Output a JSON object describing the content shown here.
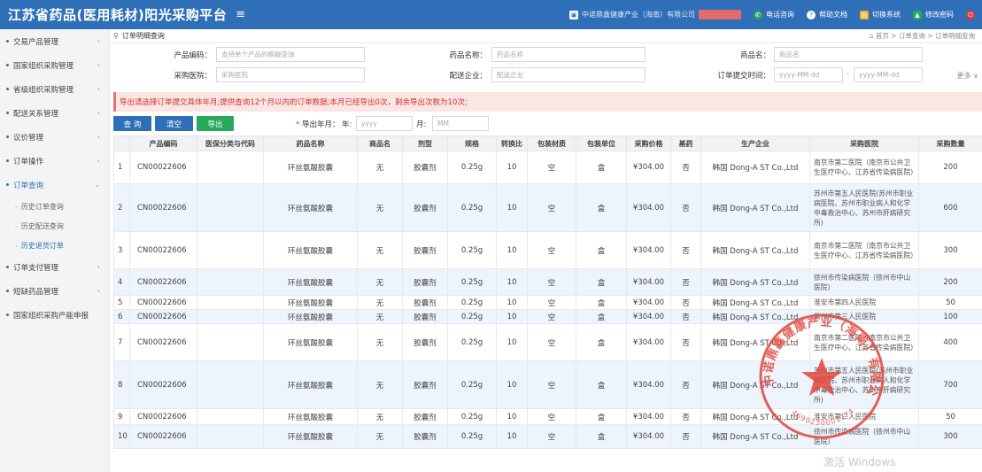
{
  "header": {
    "title": "江苏省药品(医用耗材)阳光采购平台",
    "menu_icon": "≡",
    "company": "中诺鼎鑫健康产业（海南）有限公司",
    "phone_query": "电话咨询",
    "help_docs": "帮助文档",
    "switch_system": "切换系统",
    "change_password": "修改密码",
    "exit_icon": "power-icon"
  },
  "sidebar": {
    "items": [
      {
        "label": "交易产品管理",
        "arrow": "‹"
      },
      {
        "label": "国家组织采购管理",
        "arrow": "‹"
      },
      {
        "label": "省级组织采购管理",
        "arrow": "‹"
      },
      {
        "label": "配送关系管理",
        "arrow": "‹"
      },
      {
        "label": "议价管理",
        "arrow": "‹"
      },
      {
        "label": "订单操作",
        "arrow": "‹"
      },
      {
        "label": "订单查询",
        "arrow": "⌄"
      }
    ],
    "sub_items": [
      {
        "label": "历史订单查询"
      },
      {
        "label": "历史配送查询"
      },
      {
        "label": "历史退货订单"
      }
    ],
    "items_after": [
      {
        "label": "订单支付管理",
        "arrow": "‹"
      },
      {
        "label": "短缺药品管理",
        "arrow": "‹"
      },
      {
        "label": "国家组织采购产能申报",
        "arrow": ""
      }
    ]
  },
  "breadcrumb": {
    "page": "订单明细查询",
    "home": "首页",
    "level2": "订单查询",
    "level3": "订单明细查询"
  },
  "form": {
    "product_code_label": "产品编码：",
    "product_code_placeholder": "支持单个产品的模糊查询",
    "drug_name_label": "药品名称：",
    "drug_name_placeholder": "药品名称",
    "trade_name_label": "商品名：",
    "trade_name_placeholder": "商品名",
    "hospital_label": "采购医院：",
    "hospital_placeholder": "采购医院",
    "distributor_label": "配送企业：",
    "distributor_placeholder": "配送企业",
    "order_time_label": "订单提交时间：",
    "date_from_placeholder": "yyyy-MM-dd",
    "date_sep": "-",
    "date_to_placeholder": "yyyy-MM-dd",
    "more": "更多 ∨"
  },
  "alert": "导出请选择订单提交具体年月;提供查询12个月以内的订单数据;本月已经导出0次，剩余导出次数为10次;",
  "toolbar": {
    "query": "查 询",
    "clear": "清空",
    "export": "导出",
    "export_label": "导出年月：",
    "year_label": "年:",
    "year_placeholder": "yyyy",
    "month_label": "月:",
    "month_placeholder": "MM"
  },
  "table": {
    "headers": [
      "",
      "产品编码",
      "医保分类与代码",
      "药品名称",
      "商品名",
      "剂型",
      "规格",
      "转换比",
      "包装材质",
      "包装单位",
      "采购价格",
      "基药",
      "生产企业",
      "采购医院",
      "采购数量"
    ],
    "rows": [
      {
        "idx": "1",
        "code": "CN00022606",
        "ins": "",
        "drug": "环丝氨酸胶囊",
        "trade": "无",
        "form": "胶囊剂",
        "spec": "0.25g",
        "ratio": "10",
        "pack": "空",
        "unit": "盒",
        "price": "¥304.00",
        "base": "否",
        "maker": "韩国 Dong-A ST Co.,Ltd",
        "hospital": "南京市第二医院（南京市公共卫生医疗中心、江苏省传染病医院）",
        "qty": "200"
      },
      {
        "idx": "2",
        "code": "CN00022606",
        "ins": "",
        "drug": "环丝氨酸胶囊",
        "trade": "无",
        "form": "胶囊剂",
        "spec": "0.25g",
        "ratio": "10",
        "pack": "空",
        "unit": "盒",
        "price": "¥304.00",
        "base": "否",
        "maker": "韩国 Dong-A ST Co.,Ltd",
        "hospital": "苏州市第五人民医院(苏州市职业病医院、苏州市职业病人和化学中毒救治中心、苏州市肝病研究所)",
        "qty": "600"
      },
      {
        "idx": "3",
        "code": "CN00022606",
        "ins": "",
        "drug": "环丝氨酸胶囊",
        "trade": "无",
        "form": "胶囊剂",
        "spec": "0.25g",
        "ratio": "10",
        "pack": "空",
        "unit": "盒",
        "price": "¥304.00",
        "base": "否",
        "maker": "韩国 Dong-A ST Co.,Ltd",
        "hospital": "南京市第二医院（南京市公共卫生医疗中心、江苏省传染病医院）",
        "qty": "300"
      },
      {
        "idx": "4",
        "code": "CN00022606",
        "ins": "",
        "drug": "环丝氨酸胶囊",
        "trade": "无",
        "form": "胶囊剂",
        "spec": "0.25g",
        "ratio": "10",
        "pack": "空",
        "unit": "盒",
        "price": "¥304.00",
        "base": "否",
        "maker": "韩国 Dong-A ST Co.,Ltd",
        "hospital": "徐州市传染病医院（徐州市中山医院）",
        "qty": "200"
      },
      {
        "idx": "5",
        "code": "CN00022606",
        "ins": "",
        "drug": "环丝氨酸胶囊",
        "trade": "无",
        "form": "胶囊剂",
        "spec": "0.25g",
        "ratio": "10",
        "pack": "空",
        "unit": "盒",
        "price": "¥304.00",
        "base": "否",
        "maker": "韩国 Dong-A ST Co.,Ltd",
        "hospital": "淮安市第四人民医院",
        "qty": "50"
      },
      {
        "idx": "6",
        "code": "CN00022606",
        "ins": "",
        "drug": "环丝氨酸胶囊",
        "trade": "无",
        "form": "胶囊剂",
        "spec": "0.25g",
        "ratio": "10",
        "pack": "空",
        "unit": "盒",
        "price": "¥304.00",
        "base": "否",
        "maker": "韩国 Dong-A ST Co.,Ltd",
        "hospital": "常州市第三人民医院",
        "qty": "100"
      },
      {
        "idx": "7",
        "code": "CN00022606",
        "ins": "",
        "drug": "环丝氨酸胶囊",
        "trade": "无",
        "form": "胶囊剂",
        "spec": "0.25g",
        "ratio": "10",
        "pack": "空",
        "unit": "盒",
        "price": "¥304.00",
        "base": "否",
        "maker": "韩国 Dong-A ST Co.,Ltd",
        "hospital": "南京市第二医院（南京市公共卫生医疗中心、江苏省传染病医院）",
        "qty": "400"
      },
      {
        "idx": "8",
        "code": "CN00022606",
        "ins": "",
        "drug": "环丝氨酸胶囊",
        "trade": "无",
        "form": "胶囊剂",
        "spec": "0.25g",
        "ratio": "10",
        "pack": "空",
        "unit": "盒",
        "price": "¥304.00",
        "base": "否",
        "maker": "韩国 Dong-A ST Co.,Ltd",
        "hospital": "苏州市第五人民医院(苏州市职业病医院、苏州市职业病人和化学中毒救治中心、苏州市肝病研究所)",
        "qty": "700"
      },
      {
        "idx": "9",
        "code": "CN00022606",
        "ins": "",
        "drug": "环丝氨酸胶囊",
        "trade": "无",
        "form": "胶囊剂",
        "spec": "0.25g",
        "ratio": "10",
        "pack": "空",
        "unit": "盒",
        "price": "¥304.00",
        "base": "否",
        "maker": "韩国 Dong-A ST Co.,Ltd",
        "hospital": "淮安市第三人民医院",
        "qty": "50"
      },
      {
        "idx": "10",
        "code": "CN00022606",
        "ins": "",
        "drug": "环丝氨酸胶囊",
        "trade": "无",
        "form": "胶囊剂",
        "spec": "0.25g",
        "ratio": "10",
        "pack": "空",
        "unit": "盒",
        "price": "¥304.00",
        "base": "否",
        "maker": "韩国 Dong-A ST Co.,Ltd",
        "hospital": "徐州市传染病医院（徐州市中山医院）",
        "qty": "300"
      }
    ]
  },
  "seal": {
    "text": "中诺鼎鑫健康产业（海南）有限公司",
    "number": "4690230001774",
    "color": "#e0463c"
  },
  "watermark": "激活 Windows",
  "colors": {
    "topbar": "#2f6fb7",
    "export_button": "#27a85a",
    "alert_text": "#d32f2f"
  }
}
